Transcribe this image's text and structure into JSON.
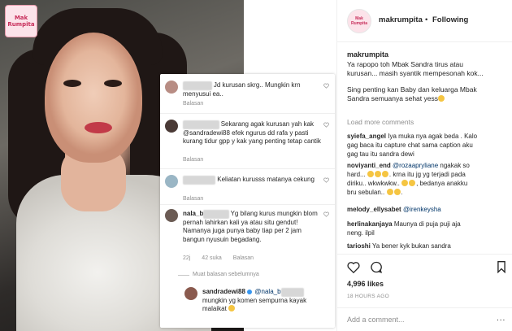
{
  "photo": {
    "logo_line1": "Mak",
    "logo_line2": "Rumpita"
  },
  "overlay_comments": [
    {
      "name_blurred": "xxxxxxxx",
      "text": " Jd kurusan skrg.. Mungkin krn menyusui ea..",
      "time": "",
      "likes": "",
      "reply_label": "Balasan"
    },
    {
      "name_blurred": "xxxxxxxxxx",
      "text": " Sekarang agak kurusan yah kak ",
      "mention": "@sandradewi88",
      "text2": " efek ngurus dd rafa y pasti kurang tidur gpp y kak yang penting tetap cantik",
      "time": "",
      "likes": "",
      "reply_label": "Balasan"
    },
    {
      "name_blurred": "xxxxxxxxx",
      "text": " Keliatan kurusss matanya cekung",
      "time": "",
      "likes": "",
      "reply_label": "Balasan"
    },
    {
      "name_prefix": "nala_b",
      "name_blurred": "xxxxxxx",
      "text": " Yg bilang kurus mungkin blom pernah lahirkan kali ya atau situ gendut! Namanya juga punya baby tiap per 2 jam bangun nyusuin begadang.",
      "time": "22j",
      "likes": "42 suka",
      "reply_label": "Balasan"
    }
  ],
  "more_replies_label": "Muat balasan sebelumnya",
  "reply": {
    "user": "sandradewi88",
    "mention_prefix": "@nala_b",
    "text": "mungkin yg komen sempurna kayak malaikat"
  },
  "header": {
    "username": "makrumpita",
    "dot": "•",
    "follow_status": "Following",
    "avatar_line1": "Mak",
    "avatar_line2": "Rumpita"
  },
  "caption": {
    "username": "makrumpita",
    "line1": "Ya rapopo toh Mbak Sandra tirus atau",
    "line2": "kurusan... masih syantik mempesonah kok...",
    "line3": "Sing penting kan Baby dan keluarga Mbak",
    "line4": "Sandra semuanya sehat yess"
  },
  "load_more": "Load more comments",
  "comments": [
    {
      "user": "syiefa_angel",
      "lines": [
        " Iya muka nya agak beda . Kalo",
        "gag baca itu capture chat sama caption aku",
        "gag tau itu sandra dewi"
      ]
    },
    {
      "user": "noviyanti_end",
      "mention": "@rozaapryliane",
      "lines": [
        " ngakak so",
        "hard...",
        "krna itu jg yg terjadi pada",
        "diriku.. wkwkwkw..",
        ", bedanya anakku",
        "bru sebulan.."
      ]
    },
    {
      "user": "melody_ellysabet",
      "mention": "@irenkeysha"
    },
    {
      "user": "herlinakanjaya",
      "lines": [
        " Maunya di puja puji aja",
        "neng. ilpil"
      ]
    },
    {
      "user": "tarioshi",
      "lines": [
        " Ya bener kyk bukan sandra"
      ]
    }
  ],
  "likes": "4,996 likes",
  "time_ago": "18 HOURS AGO",
  "add_comment_placeholder": "Add a comment...",
  "more_options": "..."
}
